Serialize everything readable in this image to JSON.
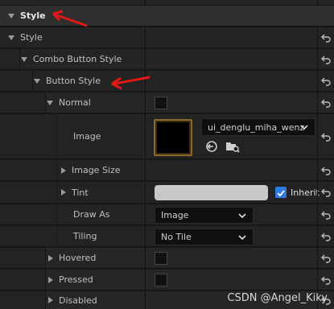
{
  "header": {
    "title": "Style"
  },
  "rows": {
    "style": "Style",
    "combo_button_style": "Combo Button Style",
    "button_style": "Button Style",
    "normal": "Normal",
    "image": "Image",
    "image_size": "Image Size",
    "tint": "Tint",
    "draw_as": "Draw As",
    "tiling": "Tiling",
    "hovered": "Hovered",
    "pressed": "Pressed",
    "disabled": "Disabled"
  },
  "image_asset": {
    "selected": "ui_denglu_miha_wenz"
  },
  "tint": {
    "inherit_label": "Inherit",
    "inherit_checked": true,
    "color": "#c8c8c8"
  },
  "draw_as": {
    "selected": "Image"
  },
  "tiling": {
    "selected": "No Tile"
  },
  "watermark": "CSDN @Angel_Kiky",
  "colors": {
    "accent": "#2d7be0",
    "arrow": "#e01818",
    "background": "#1a1a1a"
  }
}
